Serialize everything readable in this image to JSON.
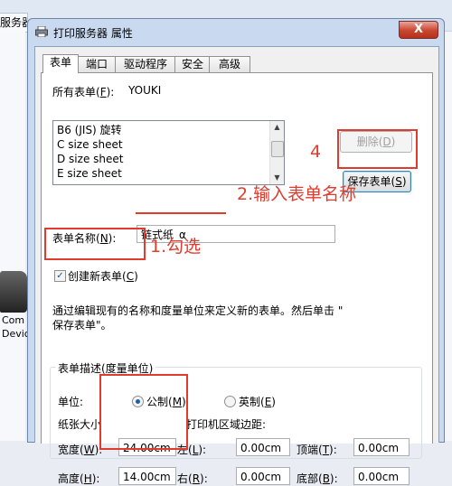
{
  "background": {
    "partial_title": "服务器",
    "device_label_1": "Com",
    "device_label_2": "Devic"
  },
  "dialog": {
    "title": "打印服务器 属性",
    "close_glyph": "X",
    "tabs": [
      "表单",
      "端口",
      "驱动程序",
      "安全",
      "高级"
    ],
    "all_forms_label": "所有表单(",
    "all_forms_key": "F",
    "all_forms_suffix": "):",
    "server_name": "YOUKI",
    "list_items": [
      "B6 (JIS) 旋转",
      "C size sheet",
      "D size sheet",
      "E size sheet"
    ],
    "delete_button": "删除(",
    "delete_key": "D",
    "delete_suffix": ")",
    "save_button": "保存表单(",
    "save_key": "S",
    "save_suffix": ")",
    "form_name_label": "表单名称(",
    "form_name_key": "N",
    "form_name_suffix": "):",
    "form_name_value": "链式纸_α",
    "create_new_label": "创建新表单(",
    "create_new_key": "C",
    "create_new_suffix": ")",
    "create_new_checked": true,
    "description_line1": "通过编辑现有的名称和度量单位来定义新的表单。然后单击 \"",
    "description_line2": "保存表单\"。",
    "group_title": "表单描述(度量单位)",
    "unit_label": "单位:",
    "metric_label": "公制(",
    "metric_key": "M",
    "metric_suffix": ")",
    "imperial_label": "英制(",
    "imperial_key": "E",
    "imperial_suffix": ")",
    "paper_size_label": "纸张大小",
    "printer_margins_label": "打印机区域边距:",
    "width_label": "宽度(",
    "width_key": "W",
    "width_suffix": "):",
    "width_value": "24.00cm",
    "height_label": "高度(",
    "height_key": "H",
    "height_suffix": "):",
    "height_value": "14.00cm",
    "left_label": "左(",
    "left_key": "L",
    "left_suffix": "):",
    "left_value": "0.00cm",
    "right_label": "右(",
    "right_key": "R",
    "right_suffix": "):",
    "right_value": "0.00cm",
    "top_label": "顶端(",
    "top_key": "T",
    "top_suffix": "):",
    "top_value": "0.00cm",
    "bottom_label": "底部(",
    "bottom_key": "B",
    "bottom_suffix": "):",
    "bottom_value": "0.00cm"
  },
  "annotations": {
    "step1": "1.勾选",
    "step2": "2.输入表单名称",
    "step4": "4"
  },
  "colors": {
    "annotation_red": "#e03b2d",
    "title_bar": "#c9daf0",
    "close_button": "#c9452e"
  }
}
